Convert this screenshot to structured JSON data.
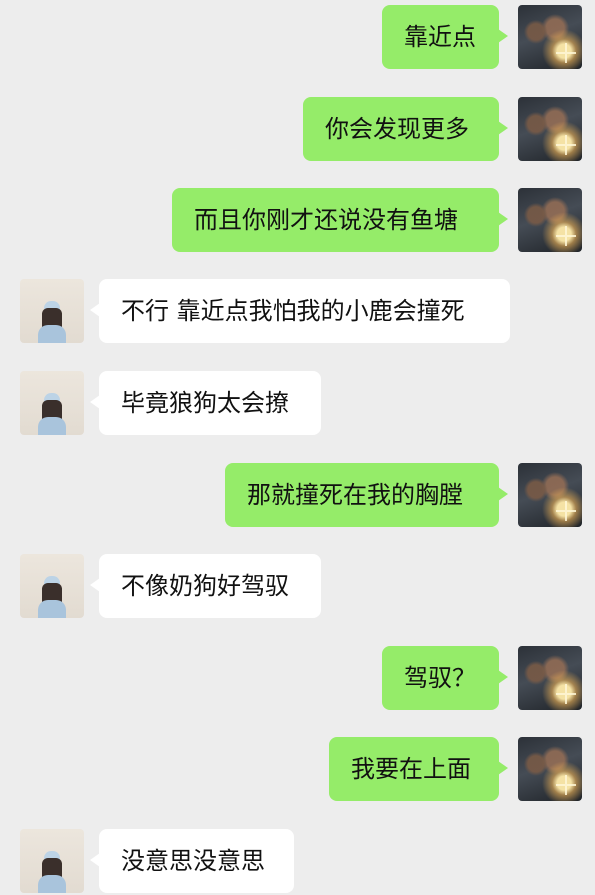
{
  "colors": {
    "background": "#ededed",
    "sent_bubble": "#95ec69",
    "received_bubble": "#ffffff",
    "text": "#111111"
  },
  "messages": [
    {
      "from": "me",
      "text": "靠近点"
    },
    {
      "from": "me",
      "text": "你会发现更多"
    },
    {
      "from": "me",
      "text": "而且你刚才还说没有鱼塘"
    },
    {
      "from": "other",
      "text": "不行 靠近点我怕我的小鹿会撞死"
    },
    {
      "from": "other",
      "text": "毕竟狼狗太会撩"
    },
    {
      "from": "me",
      "text": "那就撞死在我的胸膛"
    },
    {
      "from": "other",
      "text": "不像奶狗好驾驭"
    },
    {
      "from": "me",
      "text": "驾驭？"
    },
    {
      "from": "me",
      "text": "我要在上面"
    },
    {
      "from": "other",
      "text": "没意思没意思"
    }
  ]
}
